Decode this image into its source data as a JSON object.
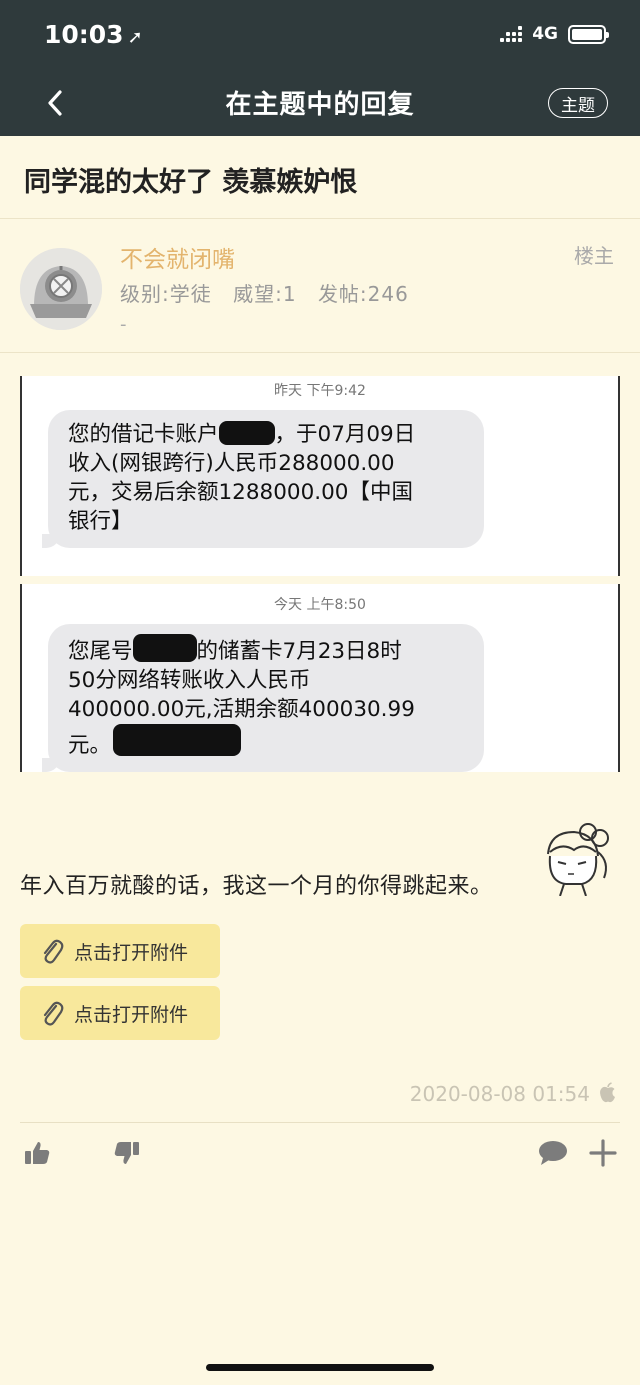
{
  "status_bar": {
    "time": "10:03",
    "network": "4G"
  },
  "nav": {
    "title": "在主题中的回复",
    "topic_button": "主题"
  },
  "thread": {
    "title": "同学混的太好了 羡慕嫉妒恨"
  },
  "author": {
    "name": "不会就闭嘴",
    "level": "级别:学徒",
    "prestige": "威望:1",
    "posts": "发帖:246",
    "signature": "-",
    "floor": "楼主"
  },
  "sms_screens": [
    {
      "timestamp": "昨天 下午9:42",
      "line1_a": "您的借记卡账户",
      "line1_b": "，于07月09日",
      "line2": "收入(网银跨行)人民币288000.00",
      "line3": "元，交易后余额1288000.00【中国",
      "line4": "银行】"
    },
    {
      "timestamp": "今天 上午8:50",
      "line1_a": "您尾号",
      "line1_b": "的储蓄卡7月23日8时",
      "line2": "50分网络转账收入人民币",
      "line3": "400000.00元,活期余额400030.99",
      "line4": "元。"
    }
  ],
  "post": {
    "text": "年入百万就酸的话，我这一个月的你得跳起来。",
    "attachments": [
      "点击打开附件",
      "点击打开附件"
    ],
    "time": "2020-08-08 01:54"
  },
  "icons": {
    "back": "chevron-left-icon",
    "attachment": "paperclip-icon",
    "device": "apple-icon",
    "like": "thumbs-up-icon",
    "dislike": "thumbs-down-icon",
    "comment": "comment-icon",
    "more": "plus-icon"
  },
  "colors": {
    "header_bg": "#2f3a3c",
    "page_bg": "#fdf8e3",
    "author_name": "#e3b46d",
    "attachment_bg": "#f8e89c"
  }
}
